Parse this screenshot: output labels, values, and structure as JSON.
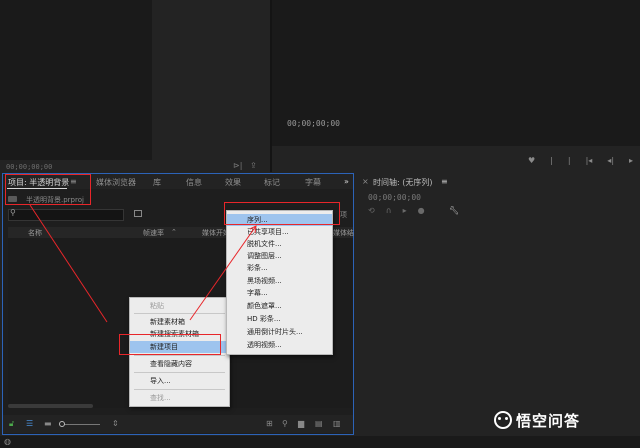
{
  "source_monitor": {
    "timecode": "00;00;00;00"
  },
  "program_monitor": {
    "timecode": "00;00;00;00"
  },
  "project_panel": {
    "tabs": [
      "项目: 半透明背景",
      "媒体浏览器",
      "库",
      "信息",
      "效果",
      "标记",
      "字幕"
    ],
    "overflow": "»",
    "file_name": "半透明背景.prproj",
    "columns": [
      "名称",
      "帧速率",
      "媒体开始",
      "媒体结"
    ],
    "right_trunc": "项"
  },
  "timeline": {
    "title": "时间轴: (无序列)",
    "timecode": "00;00;00;00"
  },
  "context_menu": {
    "items": [
      "粘贴",
      "新建素材箱",
      "新建搜索素材箱",
      "新建项目",
      "查看隐藏内容",
      "导入...",
      "查找..."
    ]
  },
  "sub_menu": {
    "items": [
      "序列...",
      "已共享项目...",
      "脱机文件...",
      "调整图层...",
      "彩条...",
      "黑场视频...",
      "字幕...",
      "颜色遮罩...",
      "HD 彩条...",
      "通用倒计时片头...",
      "透明视频..."
    ]
  },
  "watermark": {
    "text": "悟空问答"
  },
  "colors": {
    "accent_border": "#2c63b8",
    "annotation_red": "#e8262a",
    "menu_highlight": "#9ec4ee"
  }
}
